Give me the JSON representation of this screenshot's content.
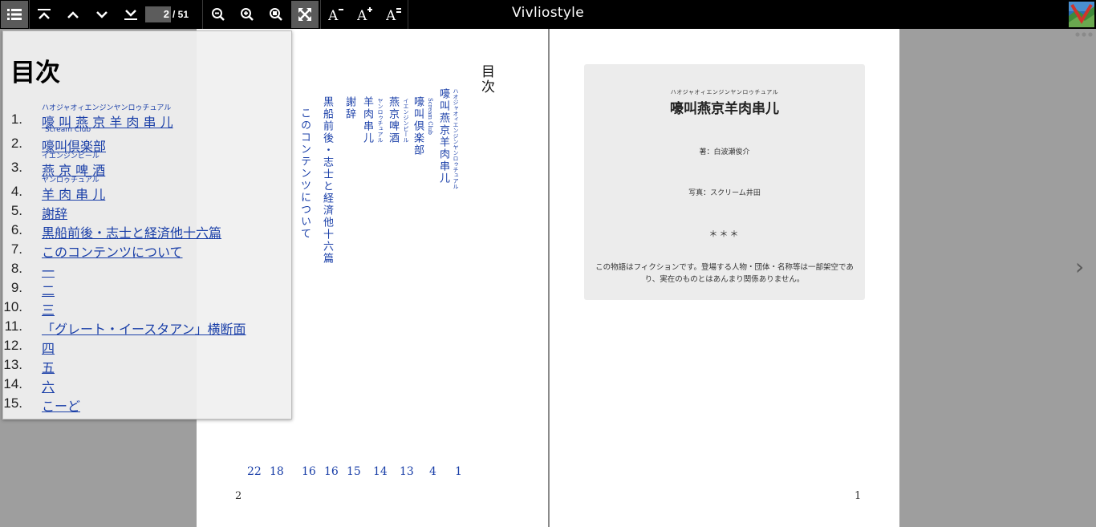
{
  "app": {
    "title": "Vivliostyle"
  },
  "toolbar": {
    "current_page": "2",
    "page_total": "/ 51"
  },
  "toc": {
    "heading": "目次",
    "items": [
      {
        "num": "1.",
        "label": "嚎 叫 燕 京 羊 肉 串 儿",
        "ruby": "ハオジャオィエンジンヤンロゥチュアル"
      },
      {
        "num": "2.",
        "label": "嚎叫倶楽部",
        "ruby": "Scream   Club"
      },
      {
        "num": "3.",
        "label": "燕 京 啤 酒",
        "ruby": "イエンジンピール"
      },
      {
        "num": "4.",
        "label": "羊 肉 串 儿",
        "ruby": "ヤンロゥチュアル"
      },
      {
        "num": "5.",
        "label": "謝辞"
      },
      {
        "num": "6.",
        "label": "黒船前後・志士と経済他十六篇"
      },
      {
        "num": "7.",
        "label": "このコンテンツについて"
      },
      {
        "num": "8.",
        "label": "一"
      },
      {
        "num": "9.",
        "label": "二"
      },
      {
        "num": "10.",
        "label": "三"
      },
      {
        "num": "11.",
        "label": "「グレート・イースタアン」横断面"
      },
      {
        "num": "12.",
        "label": "四"
      },
      {
        "num": "13.",
        "label": "五"
      },
      {
        "num": "14.",
        "label": "六"
      },
      {
        "num": "15.",
        "label": "こーど"
      }
    ]
  },
  "left_page": {
    "heading": "目次",
    "entries": [
      {
        "text": "嚎叫燕京羊肉串儿",
        "ruby": "ハオジャオィエンジンヤンロゥチュアル"
      },
      {
        "text": "嚎叫倶楽部",
        "ruby": "Scream Club"
      },
      {
        "text": "燕京啤酒",
        "ruby": "イエンジンピール"
      },
      {
        "text": "羊肉串儿",
        "ruby": "ヤンロゥチュアル"
      },
      {
        "text": "謝辞"
      },
      {
        "text": "黒船前後・志士と経済他十六篇"
      },
      {
        "text": "このコンテンツについて"
      }
    ],
    "page_refs": [
      "1",
      "4",
      "13",
      "14",
      "15",
      "16",
      "16",
      "18",
      "22"
    ],
    "folio": "2"
  },
  "right_page": {
    "ruby": "ハオジャオィエンジンヤンロゥチュアル",
    "title": "嚎叫燕京羊肉串儿",
    "author": "著：白波瀬俊介",
    "photo": "写真：スクリーム井田",
    "separator": "＊＊＊",
    "disclaimer": "この物語はフィクションです。登場する人物・団体・名称等は一部架空であり、実在のものとはあんまり関係ありません。",
    "folio": "1"
  },
  "nav": {
    "prev": "‹",
    "next": "›"
  }
}
